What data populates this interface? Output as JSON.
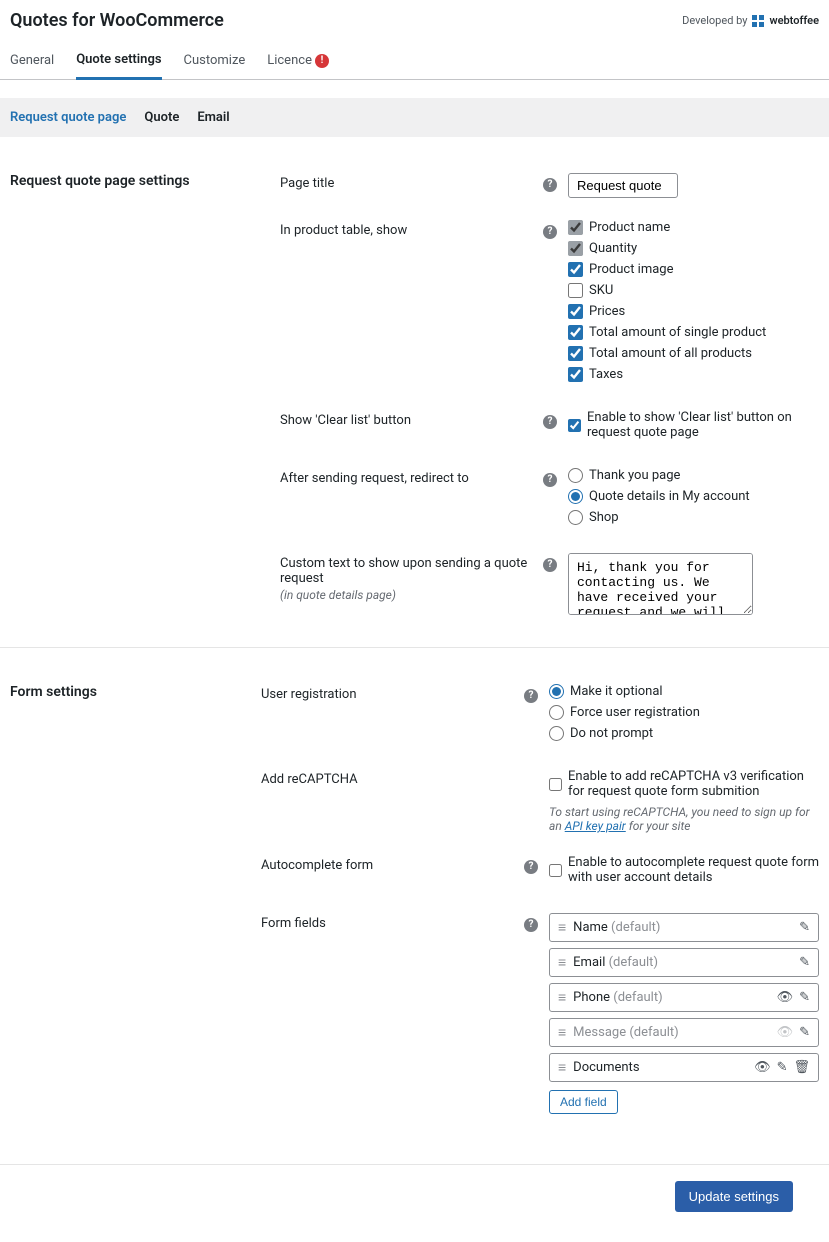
{
  "header": {
    "title": "Quotes for WooCommerce",
    "developed_by": "Developed by",
    "brand": "webtoffee"
  },
  "tabs": {
    "main": [
      "General",
      "Quote settings",
      "Customize",
      "Licence"
    ],
    "main_active": 1,
    "licence_alert": "!",
    "sub": [
      "Request quote page",
      "Quote",
      "Email"
    ],
    "sub_active": 0
  },
  "section_rqp": {
    "title": "Request quote page settings",
    "page_title": {
      "label": "Page title",
      "value": "Request quote"
    },
    "product_table": {
      "label": "In product table, show",
      "options": [
        {
          "label": "Product name",
          "checked": true,
          "locked": true
        },
        {
          "label": "Quantity",
          "checked": true,
          "locked": true
        },
        {
          "label": "Product image",
          "checked": true
        },
        {
          "label": "SKU",
          "checked": false
        },
        {
          "label": "Prices",
          "checked": true
        },
        {
          "label": "Total amount of single product",
          "checked": true
        },
        {
          "label": "Total amount of all products",
          "checked": true
        },
        {
          "label": "Taxes",
          "checked": true
        }
      ]
    },
    "clear_list": {
      "label": "Show 'Clear list' button",
      "desc": "Enable to show 'Clear list' button on request quote page",
      "checked": true
    },
    "redirect": {
      "label": "After sending request, redirect to",
      "options": [
        "Thank you page",
        "Quote details in My account",
        "Shop"
      ],
      "selected": 1
    },
    "custom_text": {
      "label": "Custom text to show upon sending a quote request",
      "sub": "(in quote details page)",
      "value": "Hi, thank you for contacting us. We have received your request and we will get back to you soon."
    }
  },
  "section_form": {
    "title": "Form settings",
    "user_reg": {
      "label": "User registration",
      "options": [
        "Make it optional",
        "Force user registration",
        "Do not prompt"
      ],
      "selected": 0
    },
    "recaptcha": {
      "label": "Add reCAPTCHA",
      "desc": "Enable to add reCAPTCHA v3 verification for request quote form submition",
      "checked": false,
      "note_pre": "To start using reCAPTCHA, you need to sign up for an ",
      "note_link": "API key pair",
      "note_post": " for your site"
    },
    "autocomplete": {
      "label": "Autocomplete form",
      "desc": "Enable to autocomplete request quote form with user account details",
      "checked": false
    },
    "form_fields": {
      "label": "Form fields",
      "items": [
        {
          "name": "Name",
          "default": true,
          "actions": [
            "edit"
          ]
        },
        {
          "name": "Email",
          "default": true,
          "actions": [
            "edit"
          ]
        },
        {
          "name": "Phone",
          "default": true,
          "actions": [
            "visible",
            "edit"
          ]
        },
        {
          "name": "Message",
          "default": true,
          "muted": true,
          "actions": [
            "hidden",
            "edit"
          ]
        },
        {
          "name": "Documents",
          "default": false,
          "actions": [
            "visible",
            "edit",
            "delete"
          ]
        }
      ],
      "default_suffix": "(default)",
      "add_label": "Add field"
    }
  },
  "update_button": "Update settings"
}
